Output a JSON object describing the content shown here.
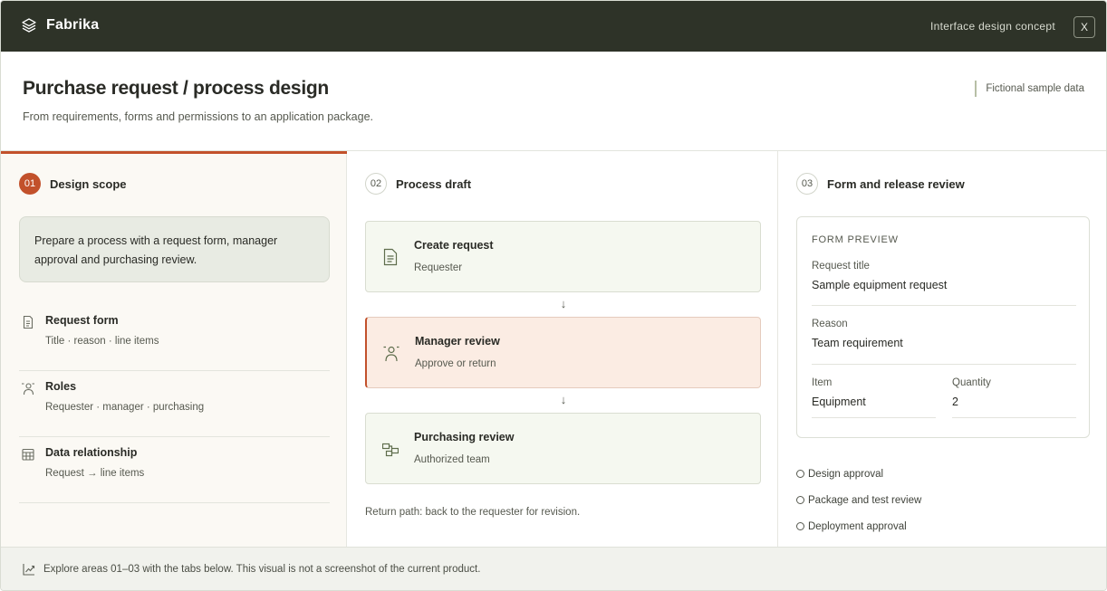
{
  "app": {
    "name": "Fabrika",
    "logo_icon": "layers-icon",
    "top_note": "Interface design concept",
    "close_label": "X"
  },
  "header": {
    "title": "Purchase request / process design",
    "subtitle": "From requirements, forms and permissions to an application package.",
    "tag": "Fictional sample data"
  },
  "colors": {
    "topbar": "#2e3328",
    "accent": "#c2512b",
    "card_green": "#f5f8f0",
    "card_highlight": "#fbece3"
  },
  "steps": [
    {
      "num": "01",
      "title": "Design scope",
      "active": true
    },
    {
      "num": "02",
      "title": "Process draft",
      "active": false
    },
    {
      "num": "03",
      "title": "Form and release review",
      "active": false
    }
  ],
  "scope": {
    "prompt": "Prepare a process with a request form, manager approval and purchasing review.",
    "items": [
      {
        "icon": "document-icon",
        "title": "Request form",
        "sub": "Title · reason · line items"
      },
      {
        "icon": "person-icon",
        "title": "Roles",
        "sub": "Requester · manager · purchasing"
      },
      {
        "icon": "table-icon",
        "title": "Data relationship",
        "sub": "Request → line items"
      }
    ]
  },
  "process": {
    "cards": [
      {
        "icon": "document-icon",
        "title": "Create request",
        "sub": "Requester",
        "highlight": false
      },
      {
        "icon": "person-icon",
        "title": "Manager review",
        "sub": "Approve or return",
        "highlight": true
      },
      {
        "icon": "org-icon",
        "title": "Purchasing review",
        "sub": "Authorized team",
        "highlight": false
      }
    ],
    "arrow": "↓",
    "return_note": "Return path: back to the requester for revision."
  },
  "form_preview": {
    "label": "FORM PREVIEW",
    "fields": [
      {
        "label": "Request title",
        "value": "Sample equipment request"
      },
      {
        "label": "Reason",
        "value": "Team requirement"
      }
    ],
    "item": {
      "label": "Item",
      "value": "Equipment"
    },
    "quantity": {
      "label": "Quantity",
      "value": "2"
    }
  },
  "checks": [
    "Design approval",
    "Package and test review",
    "Deployment approval"
  ],
  "footer": {
    "icon": "trend-icon",
    "text": "Explore areas 01–03 with the tabs below. This visual is not a screenshot of the current product."
  }
}
